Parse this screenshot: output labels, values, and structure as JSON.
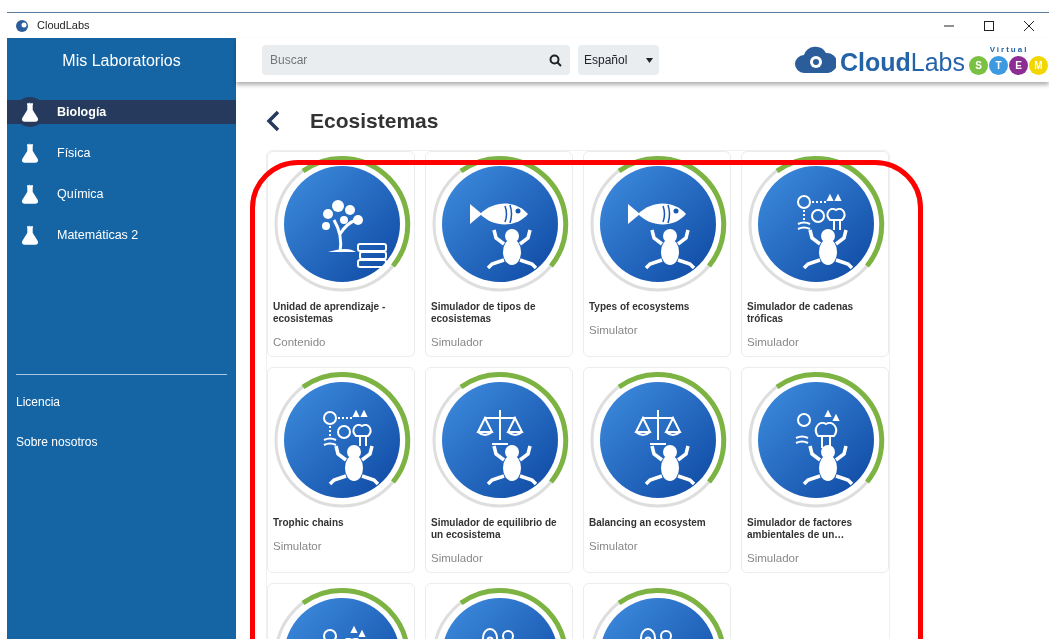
{
  "window": {
    "title": "CloudLabs"
  },
  "sidebar": {
    "title": "Mis Laboratorios",
    "items": [
      {
        "label": "Biología",
        "selected": true
      },
      {
        "label": "Física",
        "selected": false
      },
      {
        "label": "Química",
        "selected": false
      },
      {
        "label": "Matemáticas 2",
        "selected": false
      }
    ],
    "links": [
      "Licencia",
      "Sobre nosotros"
    ]
  },
  "topbar": {
    "search": {
      "placeholder": "Buscar"
    },
    "language": "Español",
    "logo": {
      "bold": "Cloud",
      "light": "Labs",
      "tagline": "Virtual",
      "letters": [
        {
          "text": "S",
          "color": "#7ac143"
        },
        {
          "text": "T",
          "color": "#3d9ae0"
        },
        {
          "text": "E",
          "color": "#8b2d94"
        },
        {
          "text": "M",
          "color": "#f2d600"
        }
      ]
    }
  },
  "page": {
    "title": "Ecosistemas"
  },
  "cards": [
    {
      "kind": "tree",
      "title": "Unidad de aprendizaje - ecosistemas",
      "type": "Contenido"
    },
    {
      "kind": "fish",
      "title": "Simulador de tipos de ecosistemas",
      "type": "Simulador"
    },
    {
      "kind": "fish",
      "title": "Types of ecosystems",
      "type": "Simulator"
    },
    {
      "kind": "cycle",
      "title": "Simulador de cadenas tróficas",
      "type": "Simulador"
    },
    {
      "kind": "cycle",
      "title": "Trophic chains",
      "type": "Simulator"
    },
    {
      "kind": "scale",
      "title": "Simulador de equilibrio de un ecosistema",
      "type": "Simulador"
    },
    {
      "kind": "scale",
      "title": "Balancing an ecosystem",
      "type": "Simulator"
    },
    {
      "kind": "factors",
      "title": "Simulador de factores ambientales de un…",
      "type": "Simulador"
    },
    {
      "kind": "factors"
    },
    {
      "kind": "cells"
    },
    {
      "kind": "cells"
    }
  ]
}
